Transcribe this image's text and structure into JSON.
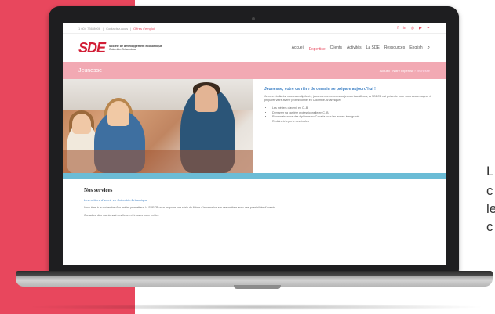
{
  "site": {
    "topbar": {
      "phone": "1 604 736-8006",
      "contact": "Contactez-nous",
      "alert": "Offres d'emploi",
      "social_icons": [
        "facebook-icon",
        "linkedin-icon",
        "instagram-icon",
        "youtube-icon",
        "twitter-icon"
      ]
    },
    "logo": {
      "mark": "SDE",
      "line1": "Société de développement économique",
      "line2": "Colombie-Britannique"
    },
    "nav": {
      "items": [
        "Accueil",
        "Expertise",
        "Clients",
        "Activités",
        "La SDE",
        "Ressources",
        "English"
      ],
      "active": "Expertise",
      "search_icon": "search-icon"
    },
    "banner": {
      "title": "Jeunesse",
      "crumb_home": "Accueil",
      "crumb_parent": "Notre expertise",
      "crumb_current": "Jeunesse"
    },
    "hero": {
      "heading": "Jeunesse, votre carrière de demain se prépare aujourd'hui !",
      "paragraph": "Jeunes étudiants, nouveaux diplômés, jeunes entrepreneurs ou jeunes travailleurs, la SDECB est présente pour vous accompagner à préparer votre avenir professionnel en Colombie-Britannique !",
      "bullets": [
        "Les métiers d'avenir en C.-B.",
        "Démarrer sa carrière professionnelle en C.-B.",
        "Reconnaissance des diplômes au Canada pour les jeunes immigrants",
        "Réduire à la perte des écoles"
      ]
    },
    "services": {
      "heading": "Nos services",
      "link": "Les métiers d'avenir en Colombie-Britannique",
      "paragraph1": "Vous êtes à la recherche d'un métier prometteur, la SDECB vous propose une série de fiches d'information sur des métiers avec des possibilités d'avenir.",
      "paragraph2": "Consultez dès maintenant ces fiches et trouvez votre métier."
    }
  },
  "side_text": [
    "L",
    "c",
    "le",
    "c"
  ],
  "colors": {
    "accent": "#e8475d",
    "brand_red": "#d21e36",
    "banner_pink": "#f2a9b3",
    "band_blue": "#6bbcd6",
    "link_blue": "#3b7fc4"
  }
}
